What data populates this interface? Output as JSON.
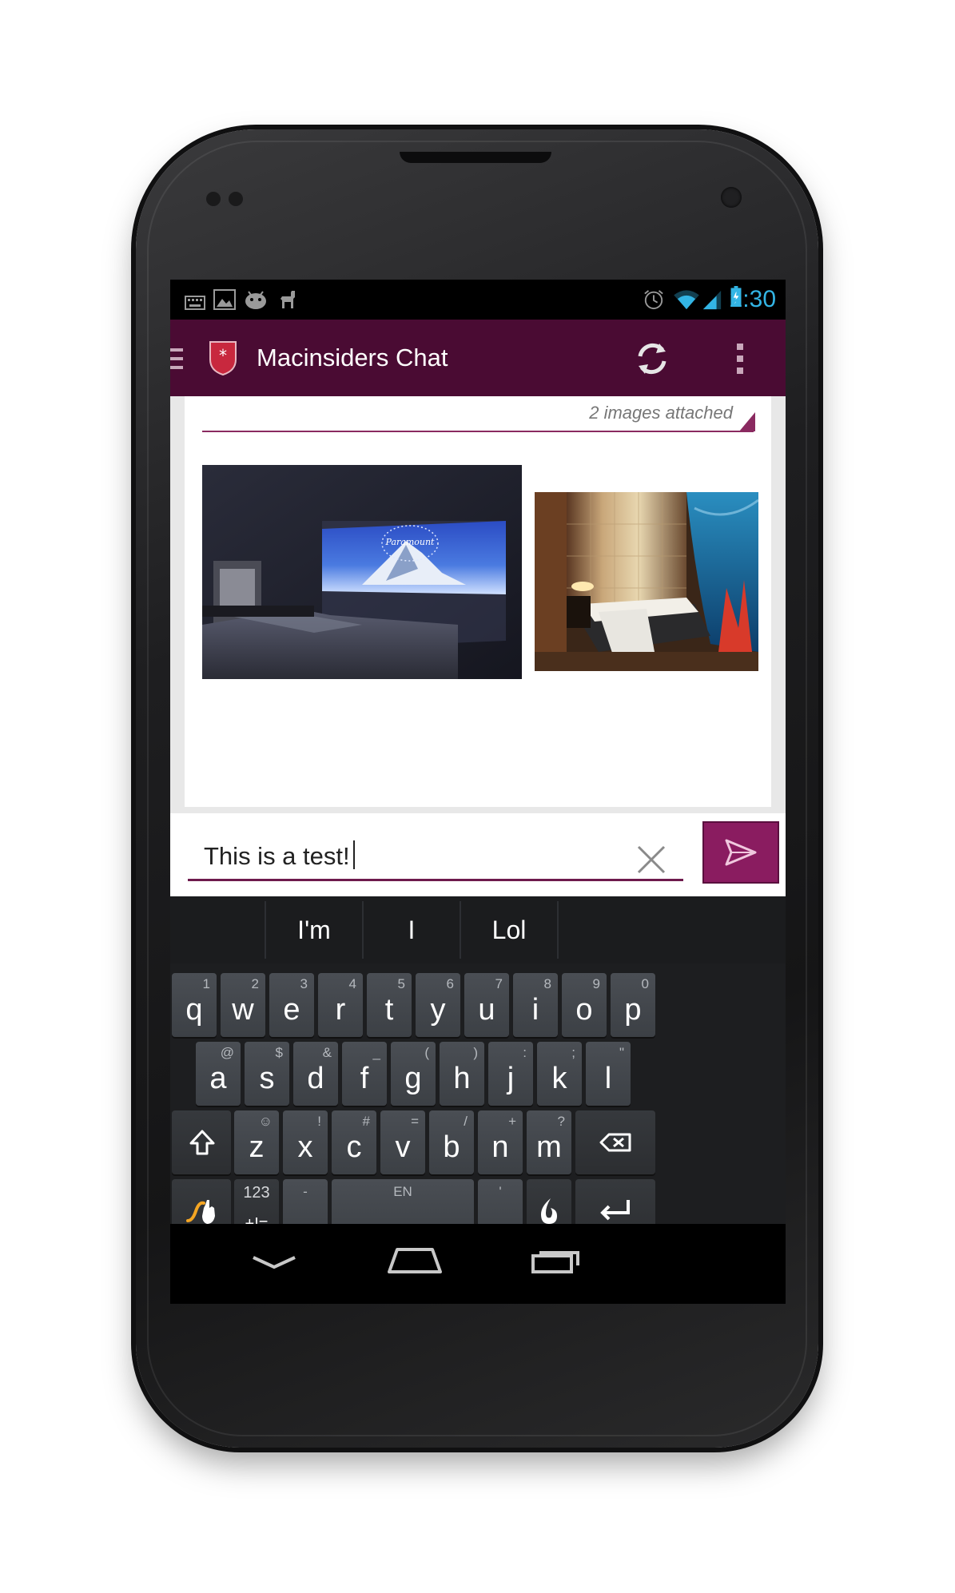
{
  "status_bar": {
    "time": "2:30",
    "left_icons": [
      "keyboard-icon",
      "image-icon",
      "android-icon",
      "llama-icon"
    ],
    "right_icons": [
      "alarm-icon",
      "wifi-icon",
      "signal-icon",
      "battery-charging-icon"
    ],
    "accent": "#33b5e5"
  },
  "action_bar": {
    "title": "Macinsiders Chat",
    "background": "#4a0b33",
    "actions": [
      "refresh-icon",
      "overflow-menu-icon"
    ]
  },
  "attachment": {
    "label": "2 images attached",
    "accent": "#8a2a60",
    "images": [
      "Projector screen in dark bedroom",
      "Modern bedroom with aquarium wall"
    ]
  },
  "compose": {
    "text": "This is a test!",
    "send_color": "#8a1c60"
  },
  "keyboard": {
    "suggestions": [
      "I'm",
      "I",
      "Lol"
    ],
    "row1": [
      {
        "k": "q",
        "h": "1"
      },
      {
        "k": "w",
        "h": "2"
      },
      {
        "k": "e",
        "h": "3"
      },
      {
        "k": "r",
        "h": "4"
      },
      {
        "k": "t",
        "h": "5"
      },
      {
        "k": "y",
        "h": "6"
      },
      {
        "k": "u",
        "h": "7"
      },
      {
        "k": "i",
        "h": "8"
      },
      {
        "k": "o",
        "h": "9"
      },
      {
        "k": "p",
        "h": "0"
      }
    ],
    "row2": [
      {
        "k": "a",
        "h": "@"
      },
      {
        "k": "s",
        "h": "$"
      },
      {
        "k": "d",
        "h": "&"
      },
      {
        "k": "f",
        "h": "_"
      },
      {
        "k": "g",
        "h": "("
      },
      {
        "k": "h",
        "h": ")"
      },
      {
        "k": "j",
        "h": ":"
      },
      {
        "k": "k",
        "h": ";"
      },
      {
        "k": "l",
        "h": "\""
      }
    ],
    "row3": [
      {
        "k": "z",
        "h": "☺"
      },
      {
        "k": "x",
        "h": "!"
      },
      {
        "k": "c",
        "h": "#"
      },
      {
        "k": "v",
        "h": "="
      },
      {
        "k": "b",
        "h": "/"
      },
      {
        "k": "n",
        "h": "+"
      },
      {
        "k": "m",
        "h": "?"
      }
    ],
    "symbols_top": "123",
    "symbols_bottom": "+!=",
    "comma": ",",
    "comma_hint": "-",
    "space_hint": "EN",
    "period": ".",
    "period_hint": "'"
  },
  "nav_bar": {
    "buttons": [
      "back-icon",
      "home-icon",
      "recents-icon"
    ]
  }
}
